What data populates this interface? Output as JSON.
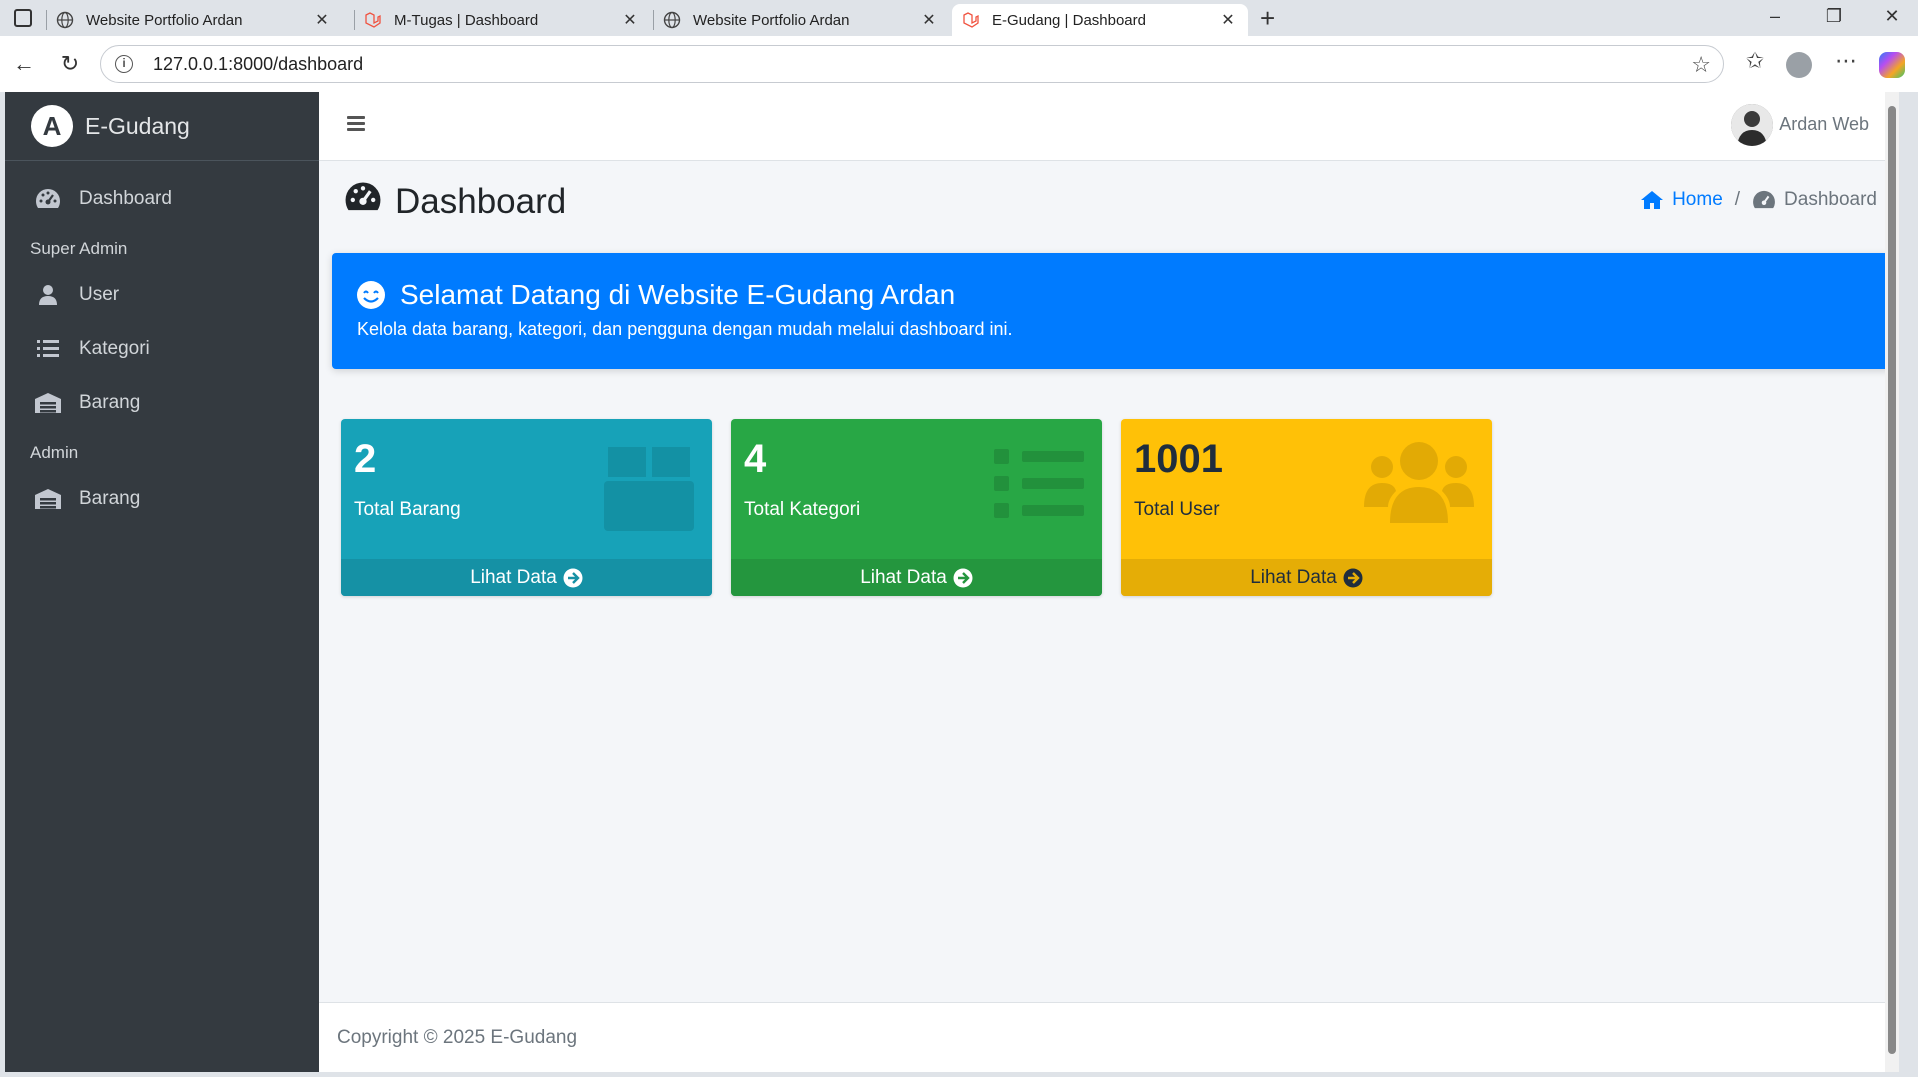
{
  "browser": {
    "tabs": [
      {
        "title": "Website Portfolio Ardan",
        "icon": "globe-icon",
        "active": false
      },
      {
        "title": "M-Tugas | Dashboard",
        "icon": "laravel-icon",
        "active": false
      },
      {
        "title": "Website Portfolio Ardan",
        "icon": "globe-icon",
        "active": false
      },
      {
        "title": "E-Gudang | Dashboard",
        "icon": "laravel-icon",
        "active": true
      }
    ],
    "url": "127.0.0.1:8000/dashboard"
  },
  "app": {
    "brand": "E-Gudang",
    "brand_logo_letter": "A",
    "user_name": "Ardan Web"
  },
  "sidebar": {
    "items": [
      {
        "type": "item",
        "label": "Dashboard",
        "icon": "gauge-icon"
      },
      {
        "type": "header",
        "label": "Super Admin"
      },
      {
        "type": "item",
        "label": "User",
        "icon": "user-icon"
      },
      {
        "type": "item",
        "label": "Kategori",
        "icon": "list-icon"
      },
      {
        "type": "item",
        "label": "Barang",
        "icon": "warehouse-icon"
      },
      {
        "type": "header",
        "label": "Admin"
      },
      {
        "type": "item",
        "label": "Barang",
        "icon": "warehouse-icon"
      }
    ]
  },
  "page": {
    "title": "Dashboard",
    "breadcrumb": {
      "home": "Home",
      "separator": "/",
      "current": "Dashboard"
    }
  },
  "welcome": {
    "title": "Selamat Datang di Website E-Gudang Ardan",
    "subtitle": "Kelola data barang, kategori, dan pengguna dengan mudah melalui dashboard ini."
  },
  "cards": [
    {
      "value": "2",
      "label": "Total Barang",
      "link": "Lihat Data",
      "color": "#17a2b8",
      "foot_color": "#1591a5",
      "icon": "box-icon"
    },
    {
      "value": "4",
      "label": "Total Kategori",
      "link": "Lihat Data",
      "color": "#28a745",
      "foot_color": "#24963e",
      "icon": "list-icon"
    },
    {
      "value": "1001",
      "label": "Total User",
      "link": "Lihat Data",
      "color": "#ffc107",
      "foot_color": "#e5ad06",
      "icon": "users-icon"
    }
  ],
  "footer": {
    "text": "Copyright © 2025 E-Gudang"
  }
}
